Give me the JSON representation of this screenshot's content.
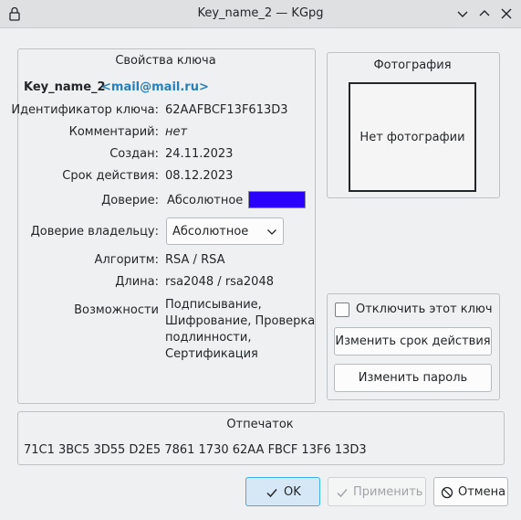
{
  "window": {
    "title": "Key_name_2 — KGpg",
    "icons": [
      "lock-icon",
      "minimize-icon",
      "maximize-icon",
      "close-icon"
    ]
  },
  "properties": {
    "group_title": "Свойства ключа",
    "key_name": "Key_name_2",
    "email": "<mail@mail.ru>",
    "rows": {
      "key_id_label": "Идентификатор ключа:",
      "key_id_value": "62AAFBCF13F613D3",
      "comment_label": "Комментарий:",
      "comment_value": "нет",
      "created_label": "Создан:",
      "created_value": "24.11.2023",
      "expires_label": "Срок действия:",
      "expires_value": "08.12.2023",
      "trust_label": "Доверие:",
      "trust_value": "Абсолютное",
      "owner_trust_label": "Доверие владельцу:",
      "owner_trust_value": "Абсолютное",
      "algorithm_label": "Алгоритм:",
      "algorithm_value": "RSA / RSA",
      "length_label": "Длина:",
      "length_value": "rsa2048 / rsa2048",
      "caps_label": "Возможности",
      "caps_lines": [
        "Подписывание,",
        "Шифрование, Проверка",
        "подлинности,",
        "Сертификация"
      ]
    },
    "trust_color": "#2a00ff"
  },
  "photo": {
    "group_title": "Фотография",
    "no_photo": "Нет фотографии"
  },
  "actions": {
    "disable_label": "Отключить этот ключ",
    "disable_checked": false,
    "change_expiry": "Изменить срок действия",
    "change_password": "Изменить пароль"
  },
  "fingerprint": {
    "group_title": "Отпечаток",
    "value": "71C1 3BC5 3D55 D2E5 7861 1730 62AA FBCF 13F6 13D3"
  },
  "footer": {
    "ok": "OK",
    "apply": "Применить",
    "cancel": "Отмена"
  },
  "colors": {
    "accent": "#3daee9",
    "link": "#2980b9"
  }
}
